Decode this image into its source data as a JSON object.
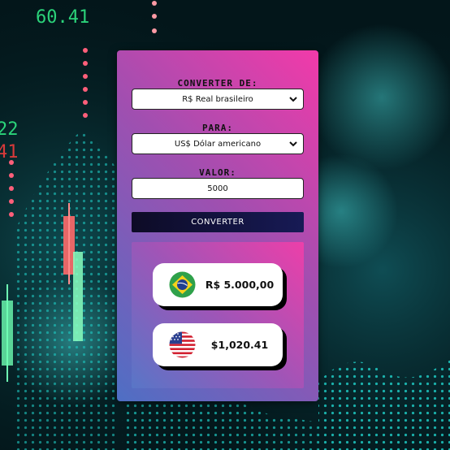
{
  "background": {
    "ticker_top": "60.41",
    "ticker_left_1": "22",
    "ticker_left_2": "41"
  },
  "form": {
    "from_label": "CONVERTER DE:",
    "from_value": "R$ Real brasileiro",
    "to_label": "PARA:",
    "to_value": "US$ Dólar americano",
    "amount_label": "VALOR:",
    "amount_value": "5000",
    "convert_label": "CONVERTER"
  },
  "results": [
    {
      "currency": "BRL",
      "flag_icon": "brazil-flag-icon",
      "amount": "R$ 5.000,00"
    },
    {
      "currency": "USD",
      "flag_icon": "usa-flag-icon",
      "amount": "$1,020.41"
    }
  ],
  "colors": {
    "card_gradient_start": "#f23aa9",
    "card_gradient_end": "#4e6fc4",
    "button_bg": "#12133d",
    "background": "#03161a"
  }
}
